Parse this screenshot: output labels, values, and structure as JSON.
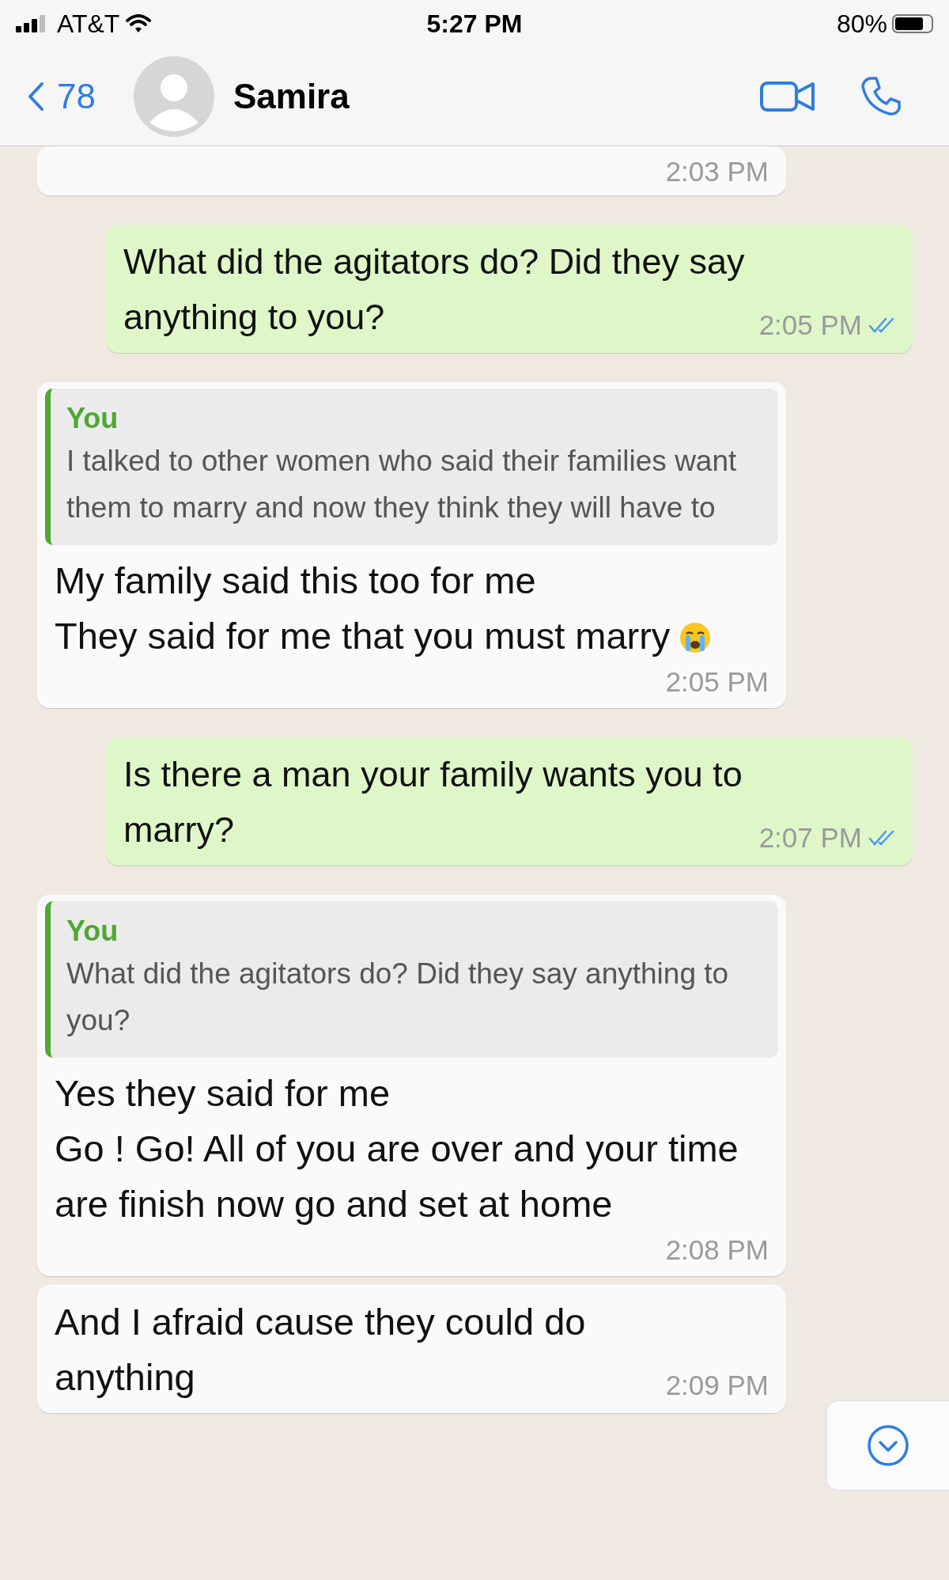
{
  "status_bar": {
    "carrier": "AT&T",
    "time": "5:27 PM",
    "battery": "80%"
  },
  "header": {
    "back_count": "78",
    "contact_name": "Samira"
  },
  "messages": [
    {
      "kind": "incoming",
      "time": "2:03 PM"
    },
    {
      "kind": "outgoing",
      "text": "What did the agitators do? Did they say anything to you?",
      "time": "2:05 PM",
      "read": true
    },
    {
      "kind": "incoming",
      "quote": {
        "author": "You",
        "text": "I talked to other women who said their families want them to marry and now they think they will have to"
      },
      "text": "My family said this too for me\nThey said for me that you must marry",
      "emoji_icon": true,
      "time": "2:05 PM"
    },
    {
      "kind": "outgoing",
      "text": "Is there a man your family wants you to marry?",
      "time": "2:07 PM",
      "read": true
    },
    {
      "kind": "incoming",
      "quote": {
        "author": "You",
        "text": "What did the agitators do? Did they say anything to you?"
      },
      "text": "Yes they said for me\nGo ! Go! All of you are over and your time are finish now go and set at home",
      "time": "2:08 PM"
    },
    {
      "kind": "incoming",
      "text": "And I afraid cause they could do anything",
      "time": "2:09 PM"
    }
  ]
}
